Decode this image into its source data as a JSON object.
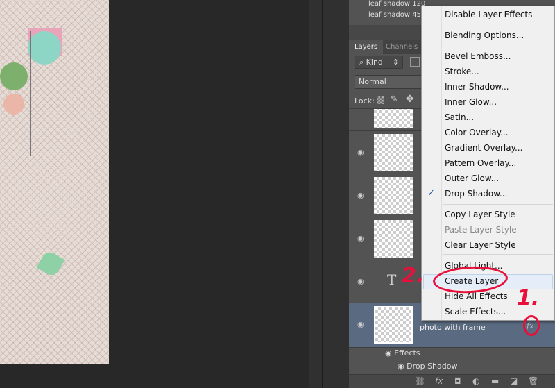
{
  "channels_top": [
    "leaf shadow 120",
    "leaf shadow 45"
  ],
  "panel": {
    "tabs": [
      "Layers",
      "Channels"
    ],
    "filter": "Kind",
    "blend_mode": "Normal",
    "lock_label": "Lock:"
  },
  "layers": [
    {
      "name": "photo with frame",
      "selected": true,
      "fx": "fx"
    }
  ],
  "effects": {
    "label": "Effects",
    "items": [
      "Drop Shadow"
    ]
  },
  "menu": {
    "items": [
      {
        "label": "Disable Layer Effects"
      },
      {
        "label": "Blending Options..."
      },
      {
        "label": "Bevel  Emboss..."
      },
      {
        "label": "Stroke..."
      },
      {
        "label": "Inner Shadow..."
      },
      {
        "label": "Inner Glow..."
      },
      {
        "label": "Satin..."
      },
      {
        "label": "Color Overlay..."
      },
      {
        "label": "Gradient Overlay..."
      },
      {
        "label": "Pattern Overlay..."
      },
      {
        "label": "Outer Glow..."
      },
      {
        "label": "Drop Shadow...",
        "checked": true
      },
      {
        "label": "Copy Layer Style"
      },
      {
        "label": "Paste Layer Style",
        "disabled": true
      },
      {
        "label": "Clear Layer Style"
      },
      {
        "label": "Global Light..."
      },
      {
        "label": "Create Layer",
        "highlighted": true
      },
      {
        "label": "Hide All Effects"
      },
      {
        "label": "Scale Effects..."
      }
    ]
  },
  "annotations": {
    "step1": "1.",
    "step2": "2."
  },
  "colors": {
    "annotation": "#e8103a",
    "menu_bg": "#f0f0f0",
    "panel_bg": "#535353",
    "selected_layer": "#5a6a80"
  }
}
